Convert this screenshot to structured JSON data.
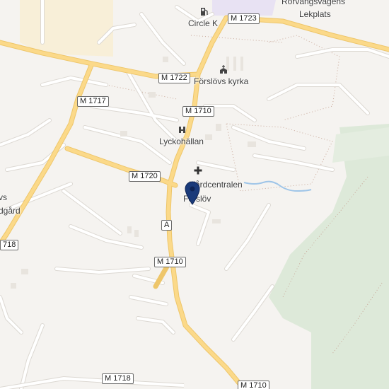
{
  "place_labels": {
    "circle_k": "Circle K",
    "forslovs_kyrka": "Förslövs kyrka",
    "lyckohallan": "Lyckohällan",
    "vardcentralen": "Vårdcentralen",
    "forslov": "Förslöv",
    "rorvangsvagens": "Rörvångsvägens",
    "lekplats": "Lekplats",
    "edge_vs": "vs",
    "edge_dgard": "dgård"
  },
  "road_shields": {
    "m1723": "M 1723",
    "m1722": "M 1722",
    "m1717": "M 1717",
    "m1710_top": "M 1710",
    "m1720": "M 1720",
    "a": "A",
    "m1710_mid": "M 1710",
    "m1718_left": "718",
    "m1718_bottom": "M 1718",
    "m1710_bottom": "M 1710"
  },
  "icons": {
    "fuel": "fuel-pump-icon",
    "church": "church-icon",
    "hotel": "lodging-icon",
    "medical": "medical-cross-icon",
    "marker": "location-pin-icon"
  },
  "colors": {
    "background": "#f5f3f0",
    "major_road": "#fbd989",
    "major_road_casing": "#eec66a",
    "minor_road": "#ffffff",
    "minor_road_casing": "#dcd8d2",
    "forest": "#dde9d9",
    "industrial": "#f8efd8",
    "pin": "#1a3a7a"
  }
}
